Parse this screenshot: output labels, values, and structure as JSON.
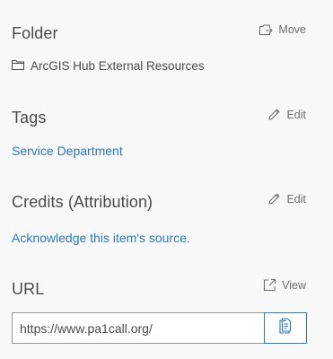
{
  "folder": {
    "title": "Folder",
    "action_label": "Move",
    "name": "ArcGIS Hub External Resources"
  },
  "tags": {
    "title": "Tags",
    "action_label": "Edit",
    "items": [
      "Service Department"
    ]
  },
  "credits": {
    "title": "Credits (Attribution)",
    "action_label": "Edit",
    "link_text": "Acknowledge this item's source."
  },
  "url": {
    "title": "URL",
    "action_label": "View",
    "value": "https://www.pa1call.org/"
  },
  "colors": {
    "link": "#2a7bb5",
    "background": "#f8f8f8",
    "text": "#4a4a4a"
  }
}
